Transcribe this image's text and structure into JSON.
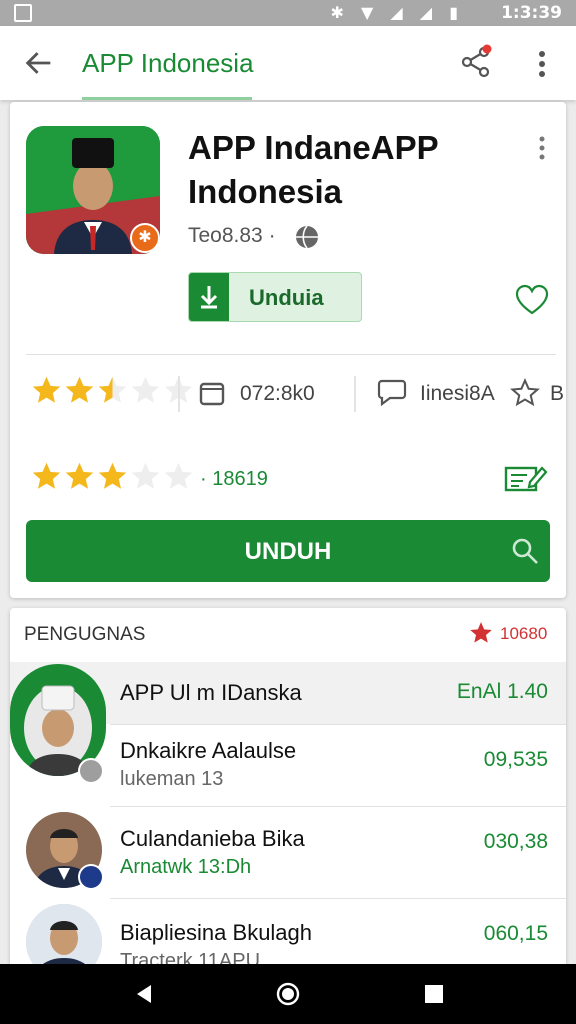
{
  "status_bar": {
    "time": "1:3:39",
    "icons": [
      "bluetooth-icon",
      "wifi-icon",
      "signal-icon",
      "signal-icon",
      "battery-icon"
    ]
  },
  "app_bar": {
    "title": "APP Indonesia",
    "icons": [
      "back-arrow-icon",
      "share-icon",
      "more-vert-icon"
    ],
    "share_badge_color": "#e53935"
  },
  "app": {
    "name_line1": "APP IndaneAPP",
    "name_line2": "Indonesia",
    "meta": "Teo8.83 ·",
    "install_label": "Unduia",
    "size": "072:8k0",
    "language": "Iinesi8A",
    "extra": "B",
    "rating_top": 2.5,
    "rating_bottom": 3,
    "rating_count": "· 18619",
    "primary_button": "UNDUH"
  },
  "section": {
    "title": "PENGUGNAS",
    "right_label": "10680",
    "items": [
      {
        "name": "APP Ul m IDanska",
        "sub": "",
        "value": "EnAl 1.40",
        "highlighted": true
      },
      {
        "name": "Dnkaikre Aalaulse",
        "sub": "lukeman 13",
        "sub_green": false,
        "value": "09,535"
      },
      {
        "name": "Culandanieba Bika",
        "sub": "Arnatwk 13:Dh",
        "sub_green": true,
        "value": "030,38"
      },
      {
        "name": "Biapliesina Bkulagh",
        "sub": "Tracterk 11APU",
        "sub_green": false,
        "value": "060,15"
      }
    ]
  },
  "colors": {
    "brand_green": "#1a8a34",
    "star": "#f5b81c",
    "accent_red": "#d23232"
  }
}
